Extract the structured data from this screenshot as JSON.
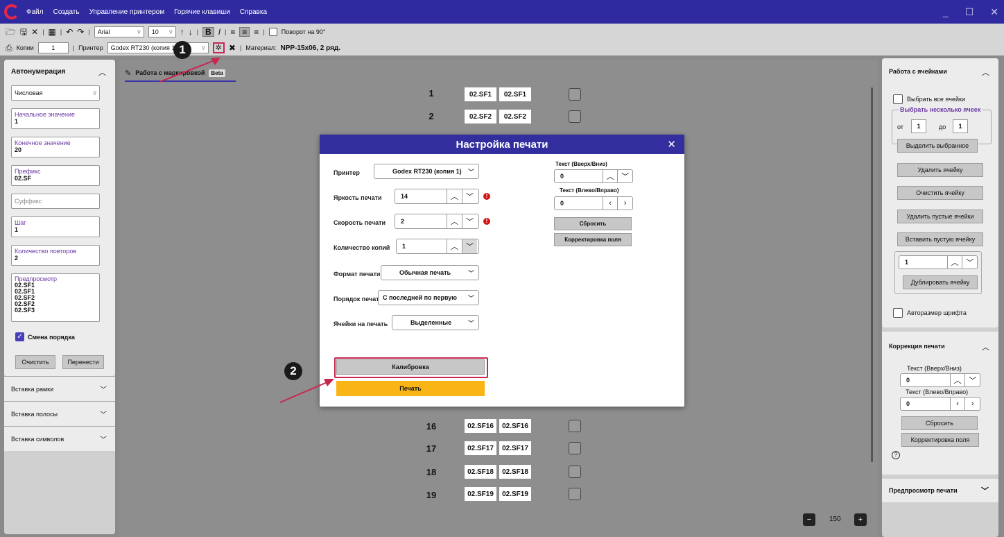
{
  "menu": [
    "Файл",
    "Создать",
    "Управление принтером",
    "Горячие клавиши",
    "Справка"
  ],
  "toolbar1": {
    "font": "Arial",
    "size": "10",
    "bold": "B",
    "italic": "I",
    "rotate_label": "Поворот на 90°"
  },
  "toolbar2": {
    "copies_label": "Копии",
    "copies_value": "1",
    "printer_label": "Принтер",
    "printer_value": "Godex RT230 (копия 1)",
    "material_label": "Материал:",
    "material_value": "NPP-15x06, 2 ряд."
  },
  "left": {
    "title": "Автонумерация",
    "type_value": "Числовая",
    "start_label": "Начальное значение",
    "start_value": "1",
    "end_label": "Конечное значение",
    "end_value": "20",
    "prefix_label": "Префикс",
    "prefix_value": "02.SF",
    "suffix_placeholder": "Суффикс",
    "step_label": "Шаг",
    "step_value": "1",
    "repeat_label": "Количество повторов",
    "repeat_value": "2",
    "preview_label": "Предпросмотр",
    "preview_lines": [
      "02.SF1",
      "02.SF1",
      "02.SF2",
      "02.SF2",
      "02.SF3"
    ],
    "order_label": "Смена порядка",
    "clear_label": "Очистить",
    "transfer_label": "Перенести",
    "acc1": "Вставка рамки",
    "acc2": "Вставка полосы",
    "acc3": "Вставка символов"
  },
  "tab": {
    "label": "Работа с маркировкой",
    "badge": "Beta"
  },
  "rows_top": [
    {
      "n": "1",
      "a": "02.SF1",
      "b": "02.SF1"
    },
    {
      "n": "2",
      "a": "02.SF2",
      "b": "02.SF2"
    }
  ],
  "rows_bottom": [
    {
      "n": "16",
      "a": "02.SF16",
      "b": "02.SF16"
    },
    {
      "n": "17",
      "a": "02.SF17",
      "b": "02.SF17"
    },
    {
      "n": "18",
      "a": "02.SF18",
      "b": "02.SF18"
    },
    {
      "n": "19",
      "a": "02.SF19",
      "b": "02.SF19"
    }
  ],
  "zoom": "150",
  "dialog": {
    "title": "Настройка печати",
    "printer_label": "Принтер",
    "printer_value": "Godex RT230 (копия 1)",
    "brightness_label": "Яркость печати",
    "brightness_value": "14",
    "speed_label": "Скорость печати",
    "speed_value": "2",
    "copies_label": "Количество копий",
    "copies_value": "1",
    "format_label": "Формат печати",
    "format_value": "Обычная печать",
    "order_label": "Порядок печати",
    "order_value": "С последней по первую",
    "cells_label": "Ячейки на печать",
    "cells_value": "Выделенные",
    "text_vert_label": "Текст (Вверх/Вниз)",
    "text_vert_value": "0",
    "text_horiz_label": "Текст (Влево/Вправо)",
    "text_horiz_value": "0",
    "reset_label": "Сбросить",
    "field_corr_label": "Корректировка поля",
    "calibrate_label": "Калибровка",
    "print_label": "Печать"
  },
  "right": {
    "cells_title": "Работа с ячейками",
    "select_all": "Выбрать все ячейки",
    "select_several": "Выбрать несколько ячеек",
    "from_label": "от",
    "from_value": "1",
    "to_label": "до",
    "to_value": "1",
    "select_btn": "Выделить выбранное",
    "delete_cell": "Удалить ячейку",
    "clear_cell": "Очистить ячейку",
    "delete_empty": "Удалить пустые ячейки",
    "insert_empty": "Вставить пустую ячейку",
    "dup_value": "1",
    "dup_btn": "Дублировать ячейку",
    "autosize": "Авторазмер шрифта",
    "corr_title": "Коррекция печати",
    "text_vert_label": "Текст (Вверх/Вниз)",
    "text_vert_value": "0",
    "text_horiz_label": "Текст (Влево/Вправо)",
    "text_horiz_value": "0",
    "reset_label": "Сбросить",
    "field_corr_label": "Корректировка поля",
    "preview_title": "Предпросмотр печати"
  },
  "callouts": [
    "1",
    "2"
  ],
  "colors": {
    "titlebar": "#2f2aa0",
    "dialog_header": "#322e9e",
    "print_button": "#f9b515",
    "highlight": "#c8264f",
    "label_purple": "#6a38a4"
  }
}
